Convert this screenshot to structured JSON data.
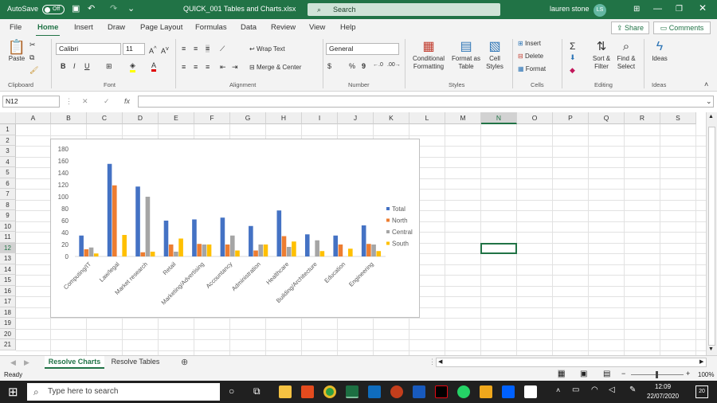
{
  "titlebar": {
    "autosave_label": "AutoSave",
    "autosave_state": "Off",
    "filename": "QUICK_001 Tables and Charts.xlsx",
    "search_placeholder": "Search",
    "user_name": "lauren stone",
    "user_initials": "LS"
  },
  "menu": {
    "tabs": [
      "File",
      "Home",
      "Insert",
      "Draw",
      "Page Layout",
      "Formulas",
      "Data",
      "Review",
      "View",
      "Help"
    ],
    "active": "Home",
    "share_label": "Share",
    "comments_label": "Comments"
  },
  "ribbon": {
    "clipboard": {
      "paste": "Paste",
      "group": "Clipboard"
    },
    "font": {
      "name": "Calibri",
      "size": "11",
      "group": "Font",
      "bold": "B",
      "italic": "I",
      "underline": "U"
    },
    "alignment": {
      "wrap": "Wrap Text",
      "merge": "Merge & Center",
      "group": "Alignment"
    },
    "number": {
      "format": "General",
      "group": "Number",
      "currency": "$",
      "percent": "%",
      "comma": "9"
    },
    "styles": {
      "conditional": [
        "Conditional",
        "Formatting"
      ],
      "format_table": [
        "Format as",
        "Table"
      ],
      "cell_styles": [
        "Cell",
        "Styles"
      ],
      "group": "Styles"
    },
    "cells": {
      "insert": "Insert",
      "delete": "Delete",
      "format": "Format",
      "group": "Cells"
    },
    "editing": {
      "sort": [
        "Sort &",
        "Filter"
      ],
      "find": [
        "Find &",
        "Select"
      ],
      "group": "Editing"
    },
    "ideas": {
      "label": "Ideas",
      "group": "Ideas"
    }
  },
  "formula_bar": {
    "name_box": "N12",
    "fx": "fx",
    "value": ""
  },
  "columns": [
    "A",
    "B",
    "C",
    "D",
    "E",
    "F",
    "G",
    "H",
    "I",
    "J",
    "K",
    "L",
    "M",
    "N",
    "O",
    "P",
    "Q",
    "R",
    "S"
  ],
  "rows": [
    "1",
    "2",
    "3",
    "4",
    "5",
    "6",
    "7",
    "8",
    "9",
    "10",
    "11",
    "12",
    "13",
    "14",
    "15",
    "16",
    "17",
    "18",
    "19",
    "20",
    "21"
  ],
  "selected_cell": "N12",
  "chart_data": {
    "type": "bar",
    "categories": [
      "Computing/IT",
      "Law/legal",
      "Market research",
      "Retail",
      "Marketing/Advertising",
      "Accountancy",
      "Administration",
      "Healthcare",
      "Building/Architecture",
      "Education",
      "Engineering"
    ],
    "series": [
      {
        "name": "Total",
        "color": "#4472c4",
        "values": [
          35,
          155,
          117,
          60,
          62,
          65,
          51,
          77,
          37,
          35,
          52
        ]
      },
      {
        "name": "North",
        "color": "#ed7d31",
        "values": [
          12,
          119,
          7,
          20,
          21,
          20,
          10,
          34,
          0,
          20,
          21
        ]
      },
      {
        "name": "Central",
        "color": "#a5a5a5",
        "values": [
          15,
          0,
          100,
          8,
          20,
          35,
          20,
          16,
          27,
          0,
          20
        ]
      },
      {
        "name": "South",
        "color": "#ffc000",
        "values": [
          5,
          36,
          8,
          30,
          20,
          10,
          20,
          25,
          9,
          13,
          9
        ]
      }
    ],
    "yticks": [
      "0",
      "20",
      "40",
      "60",
      "80",
      "100",
      "120",
      "140",
      "160",
      "180"
    ],
    "ylim": [
      0,
      180
    ],
    "legend": "right",
    "grid": false
  },
  "sheets": {
    "tabs": [
      "Resolve Charts",
      "Resolve Tables"
    ],
    "active": "Resolve Charts"
  },
  "status": {
    "text": "Ready",
    "zoom": "100%"
  },
  "taskbar": {
    "search_placeholder": "Type here to search",
    "time": "12:09",
    "date": "22/07/2020",
    "notifications": "20"
  }
}
